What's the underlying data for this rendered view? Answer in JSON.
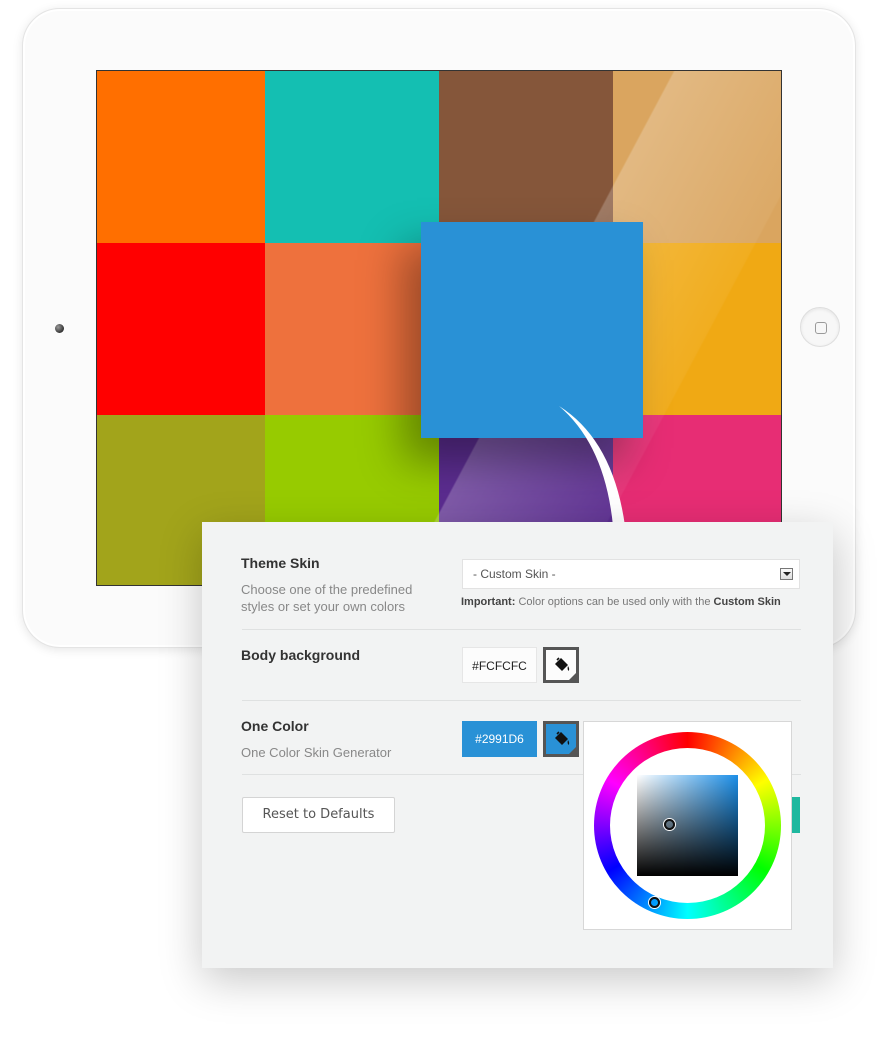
{
  "colors": {
    "tiles": [
      "#ff6f00",
      "#14bfb2",
      "#85563a",
      "#daa55f",
      "#ff0000",
      "#ee713d",
      "#2a8bd1",
      "#f0a914",
      "#a2a41b",
      "#97cb00",
      "#5c2d91",
      "#e72d74"
    ],
    "selected": "#2991D6",
    "panel_bg": "#f2f3f3",
    "accent": "#1fb89f"
  },
  "theme_skin": {
    "label": "Theme Skin",
    "desc_line1": "Choose one of the predefined",
    "desc_line2": "styles or set your own colors",
    "select_value": "- Custom Skin -",
    "note_prefix": "Important:",
    "note_text": " Color options can be used only with the ",
    "note_emphasis": "Custom Skin"
  },
  "body_background": {
    "label": "Body background",
    "value": "#FCFCFC",
    "picker_icon": "paint-bucket-icon"
  },
  "one_color": {
    "label": "One Color",
    "desc": "One Color Skin Generator",
    "value": "#2991D6",
    "picker_icon": "paint-bucket-icon"
  },
  "reset_label": "Reset to Defaults"
}
